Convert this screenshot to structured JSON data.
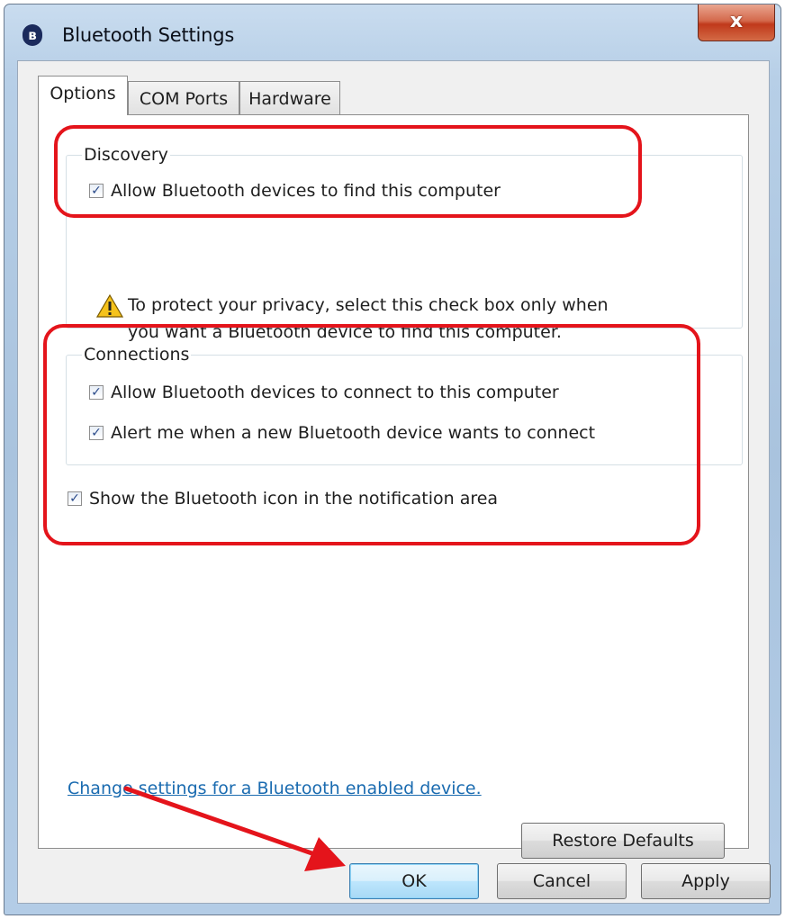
{
  "window": {
    "title": "Bluetooth Settings",
    "close_label": "x",
    "title_icon_name": "bluetooth-icon"
  },
  "tabs": [
    {
      "label": "Options",
      "active": true
    },
    {
      "label": "COM Ports",
      "active": false
    },
    {
      "label": "Hardware",
      "active": false
    }
  ],
  "discovery": {
    "group_label": "Discovery",
    "allow_find": {
      "label": "Allow Bluetooth devices to find this computer",
      "checked": true
    },
    "warning": {
      "icon": "warning-icon",
      "line1": "To protect your privacy, select this check box only when",
      "line2": "you want a Bluetooth device to find this computer."
    }
  },
  "connections": {
    "group_label": "Connections",
    "allow_connect": {
      "label": "Allow Bluetooth devices to connect to this computer",
      "checked": true
    },
    "alert_new": {
      "label": "Alert me when a new Bluetooth device wants to connect",
      "checked": true
    }
  },
  "show_icon": {
    "label": "Show the Bluetooth icon in the notification area",
    "checked": true
  },
  "link_text": "Change settings for a Bluetooth enabled device.",
  "buttons": {
    "restore": "Restore Defaults",
    "ok": "OK",
    "cancel": "Cancel",
    "apply": "Apply"
  },
  "colors": {
    "annotation_red": "#e4141b",
    "link_blue": "#1a6bb0"
  },
  "check_glyph": "✓"
}
